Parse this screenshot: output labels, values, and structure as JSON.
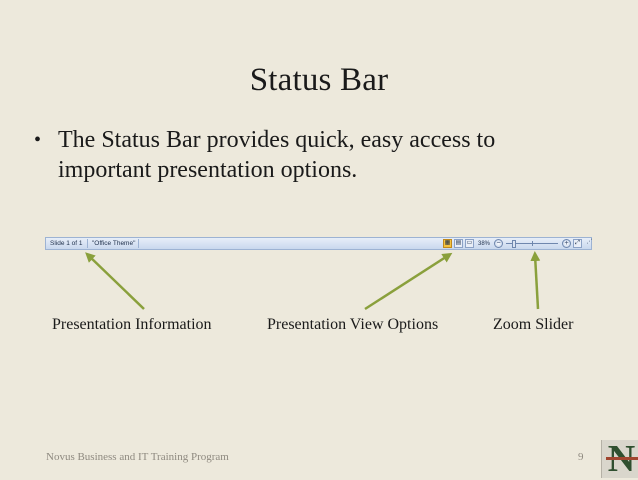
{
  "slide": {
    "title": "Status Bar",
    "bullet_marker": "•",
    "bullet_text": "The Status Bar provides quick, easy access to important presentation options."
  },
  "status_bar": {
    "slide_info": "Slide 1 of 1",
    "theme": "\"Office Theme\"",
    "view_buttons": [
      "normal-view",
      "slide-sorter-view",
      "slide-show-view"
    ],
    "zoom_percent": "38%",
    "zoom_out": "−",
    "zoom_in": "+",
    "zoom_level_percent": 38
  },
  "labels": {
    "presentation_information": "Presentation Information",
    "presentation_view_options": "Presentation View Options",
    "zoom_slider": "Zoom Slider"
  },
  "footer": {
    "program": "Novus Business and IT Training Program",
    "page_number": "9",
    "logo_letter": "N"
  },
  "colors": {
    "background": "#ede9dc",
    "arrow": "#8aa03c",
    "status_bar": "#c9d8ee",
    "logo_green": "#2f4f2f",
    "logo_red": "#a0452f"
  }
}
